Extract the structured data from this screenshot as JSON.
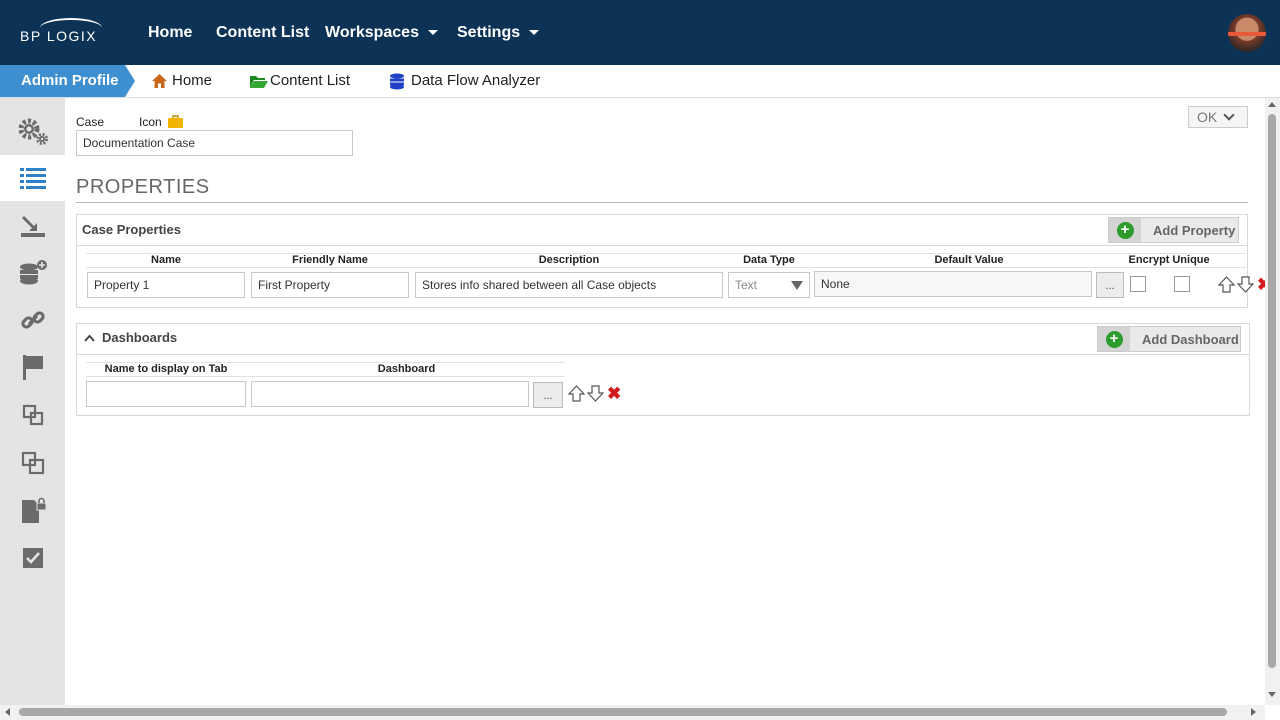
{
  "topnav": {
    "logo": "BP LOGIX",
    "items": [
      {
        "label": "Home"
      },
      {
        "label": "Content List"
      },
      {
        "label": "Workspaces"
      },
      {
        "label": "Settings"
      }
    ]
  },
  "breadcrumb": {
    "admin": "Admin Profile",
    "links": [
      "Home",
      "Content List",
      "Data Flow Analyzer"
    ]
  },
  "sidebar": {
    "icons": [
      "gears-icon",
      "list-icon",
      "import-icon",
      "database-add-icon",
      "link-icon",
      "flag-icon",
      "duplicate-icon",
      "copy-icon",
      "locked-file-icon",
      "checkbox-icon"
    ]
  },
  "form": {
    "case_label": "Case",
    "icon_label": "Icon",
    "case_value": "Documentation Case",
    "ok_label": "OK"
  },
  "properties": {
    "title": "PROPERTIES",
    "case_properties": {
      "heading": "Case Properties",
      "add_label": "Add Property",
      "columns": [
        "Name",
        "Friendly Name",
        "Description",
        "Data Type",
        "Default Value",
        "Encrypt",
        "Unique"
      ],
      "row": {
        "name": "Property 1",
        "friendly_name": "First Property",
        "description": "Stores info shared between all Case objects",
        "data_type": "Text",
        "default_value": "None",
        "dots": "..."
      }
    },
    "dashboards": {
      "heading": "Dashboards",
      "add_label": "Add Dashboard",
      "columns": [
        "Name to display on Tab",
        "Dashboard"
      ],
      "dots": "..."
    }
  },
  "colors": {
    "topbar": "#0c3355",
    "admin_crumb": "#3d8fd0",
    "plus_green": "#2c9c2c",
    "delete_red": "#d21b1b"
  }
}
